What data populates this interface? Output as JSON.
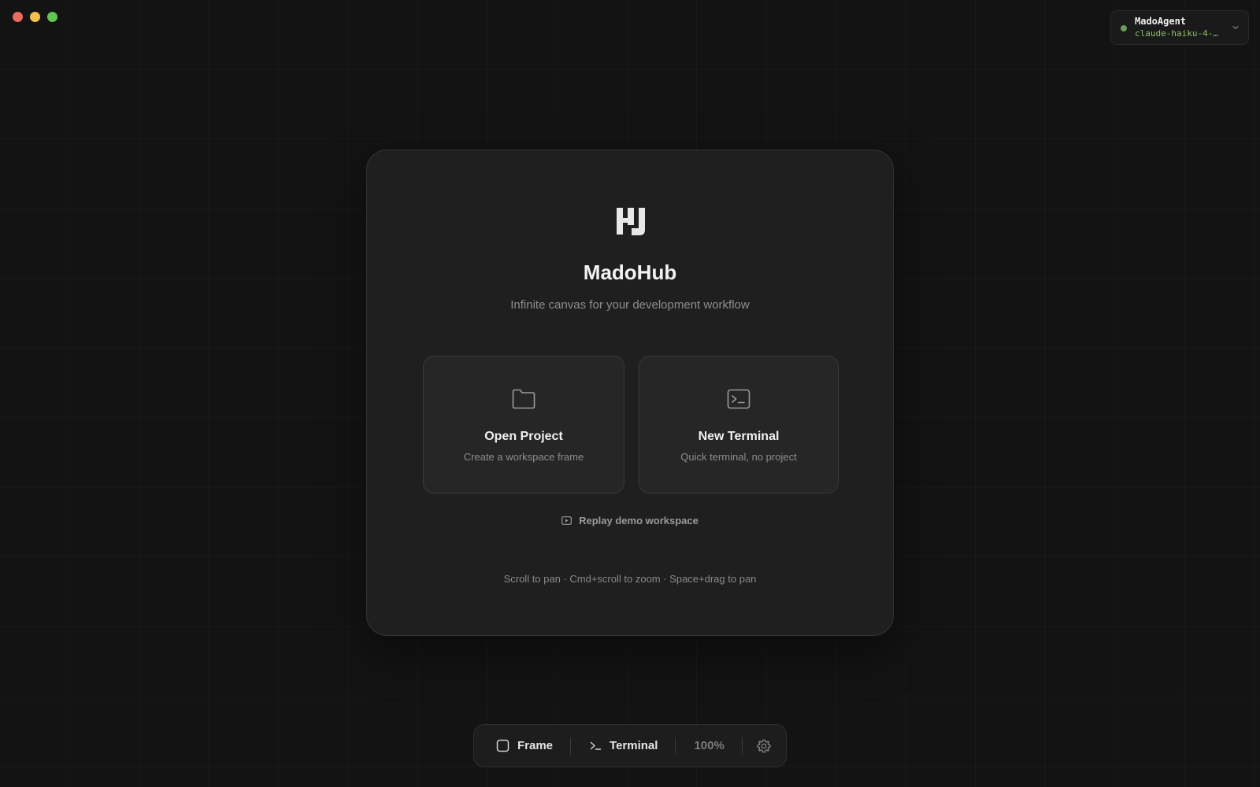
{
  "window": {
    "controls": [
      "close",
      "minimize",
      "maximize"
    ]
  },
  "agent": {
    "name": "MadoAgent",
    "model": "claude-haiku-4-…",
    "status_color": "#6d9a5a",
    "model_color": "#8fbf6e",
    "icon": "chevron-down-icon"
  },
  "welcome": {
    "logo_icon": "madohub-logo-icon",
    "title": "MadoHub",
    "subtitle": "Infinite canvas for your development workflow",
    "actions": [
      {
        "title": "Open Project",
        "description": "Create a workspace frame",
        "icon": "folder-icon"
      },
      {
        "title": "New Terminal",
        "description": "Quick terminal, no project",
        "icon": "terminal-icon"
      }
    ],
    "replay_label": "Replay demo workspace",
    "replay_icon": "play-icon",
    "hint": "Scroll to pan · Cmd+scroll to zoom · Space+drag to pan"
  },
  "toolbar": {
    "frame_label": "Frame",
    "terminal_label": "Terminal",
    "zoom": "100%",
    "settings_icon": "gear-icon"
  }
}
